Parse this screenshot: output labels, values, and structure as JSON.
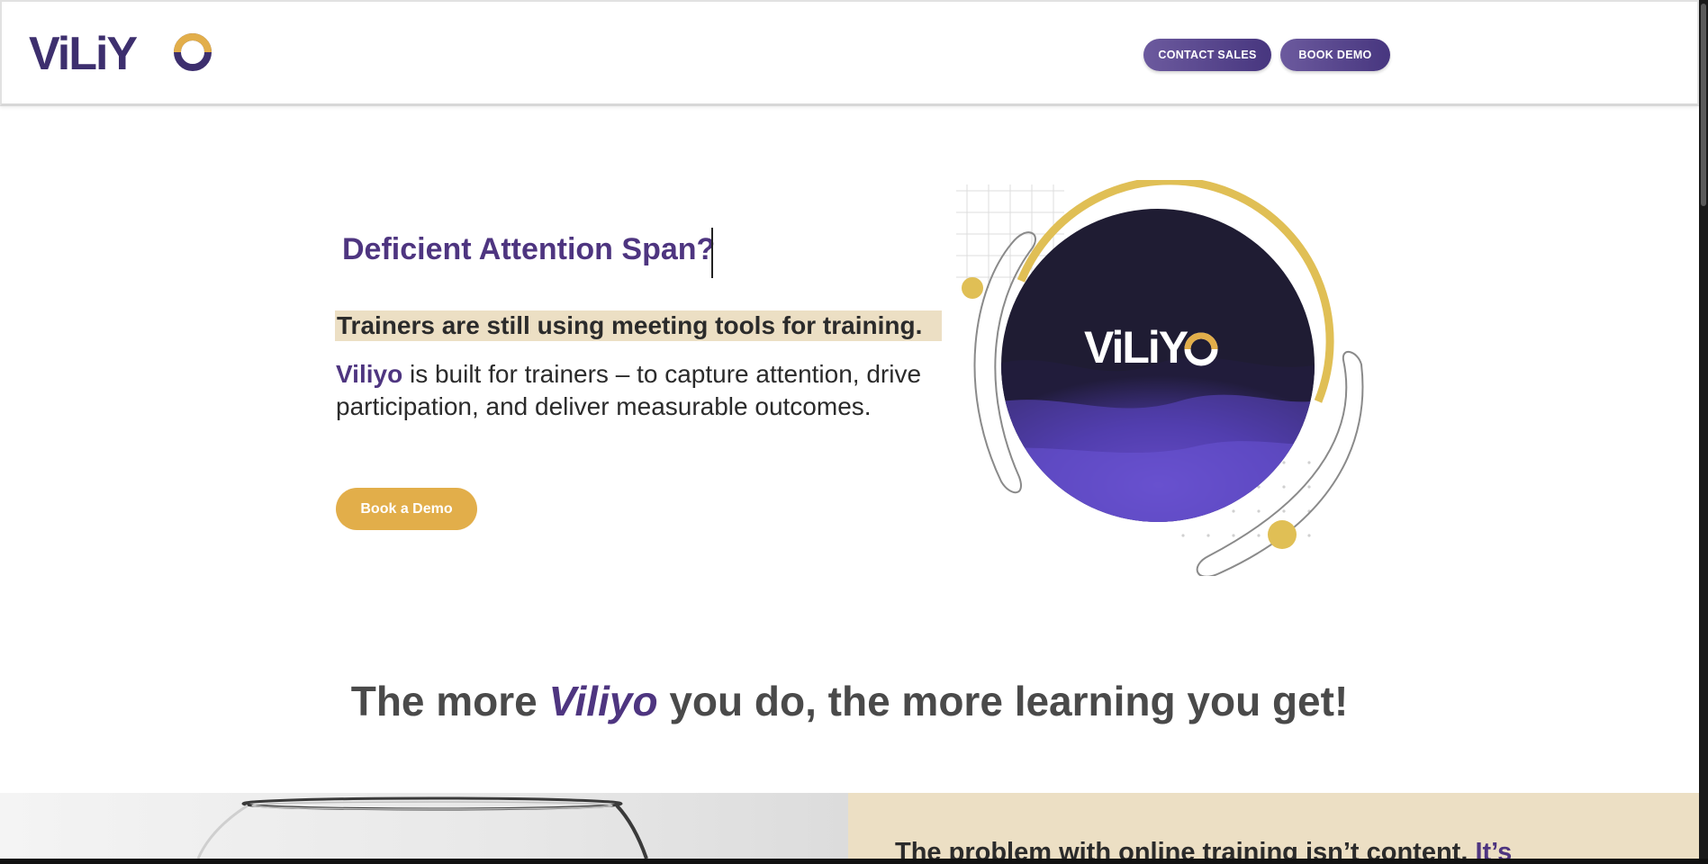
{
  "header": {
    "logo_alt": "ViLiYO",
    "contact_sales": "CONTACT SALES",
    "book_demo": "BOOK DEMO"
  },
  "hero": {
    "title": "Deficient Attention Span?",
    "subtitle": "Trainers are still using meeting tools for training.",
    "body_brand": "Viliyo",
    "body_text": " is built for trainers – to capture attention, drive participation, and deliver measurable outcomes.",
    "cta": "Book a Demo",
    "art_logo": "ViLiYO"
  },
  "tagline": {
    "before": "The more ",
    "brand": "Viliyo",
    "after": " you do, the more learning you get!"
  },
  "problem": {
    "text": "The problem with online training isn’t content. ",
    "accent": "It’s"
  },
  "colors": {
    "brand_purple": "#4e3580",
    "accent_gold": "#e2ae4a",
    "highlight_beige": "#ecdfc4"
  }
}
